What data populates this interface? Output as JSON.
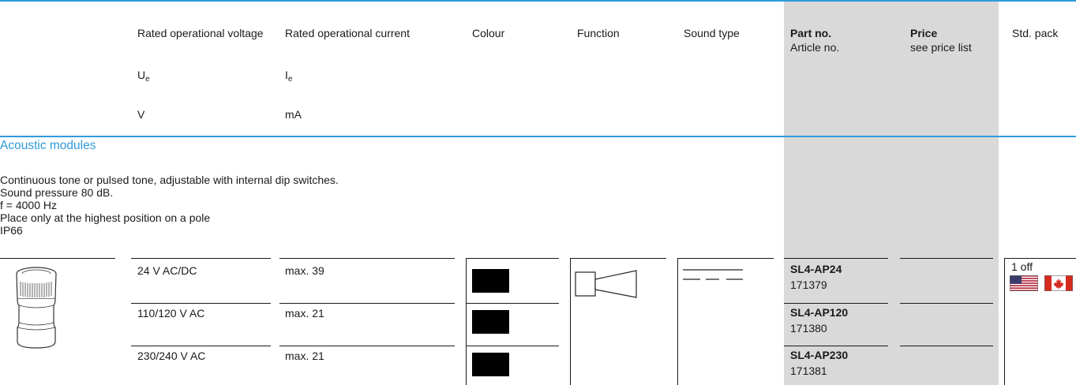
{
  "header": {
    "voltage_label": "Rated operational voltage",
    "voltage_symbol": "U",
    "voltage_sub": "e",
    "voltage_unit": "V",
    "current_label": "Rated operational current",
    "current_symbol": "I",
    "current_sub": "e",
    "current_unit": "mA",
    "colour_label": "Colour",
    "function_label": "Function",
    "sound_label": "Sound type",
    "partno_label": "Part no.",
    "article_label": "Article no.",
    "price_label": "Price",
    "price_sub": "see price list",
    "stdpack_label": "Std. pack"
  },
  "section": {
    "title": "Acoustic modules",
    "description": [
      "Continuous tone or pulsed tone, adjustable with internal dip switches.",
      "Sound pressure 80 dB.",
      "f = 4000 Hz",
      "Place only at the highest position on a pole",
      "IP66"
    ]
  },
  "rows": [
    {
      "voltage": "24 V AC/DC",
      "current": "max. 39",
      "part_no": "SL4-AP24",
      "article_no": "171379"
    },
    {
      "voltage": "110/120 V AC",
      "current": "max. 21",
      "part_no": "SL4-AP120",
      "article_no": "171380"
    },
    {
      "voltage": "230/240 V AC",
      "current": "max. 21",
      "part_no": "SL4-AP230",
      "article_no": "171381"
    }
  ],
  "std_pack": "1 off",
  "colors": {
    "accent": "#2e9bdc",
    "price_column": "#d9d9d9",
    "swatch": "#000000"
  },
  "icons": [
    "acoustic-module-product-icon",
    "horn-function-icon",
    "pulsed-tone-sound-icon",
    "us-flag-icon",
    "canada-flag-icon"
  ]
}
